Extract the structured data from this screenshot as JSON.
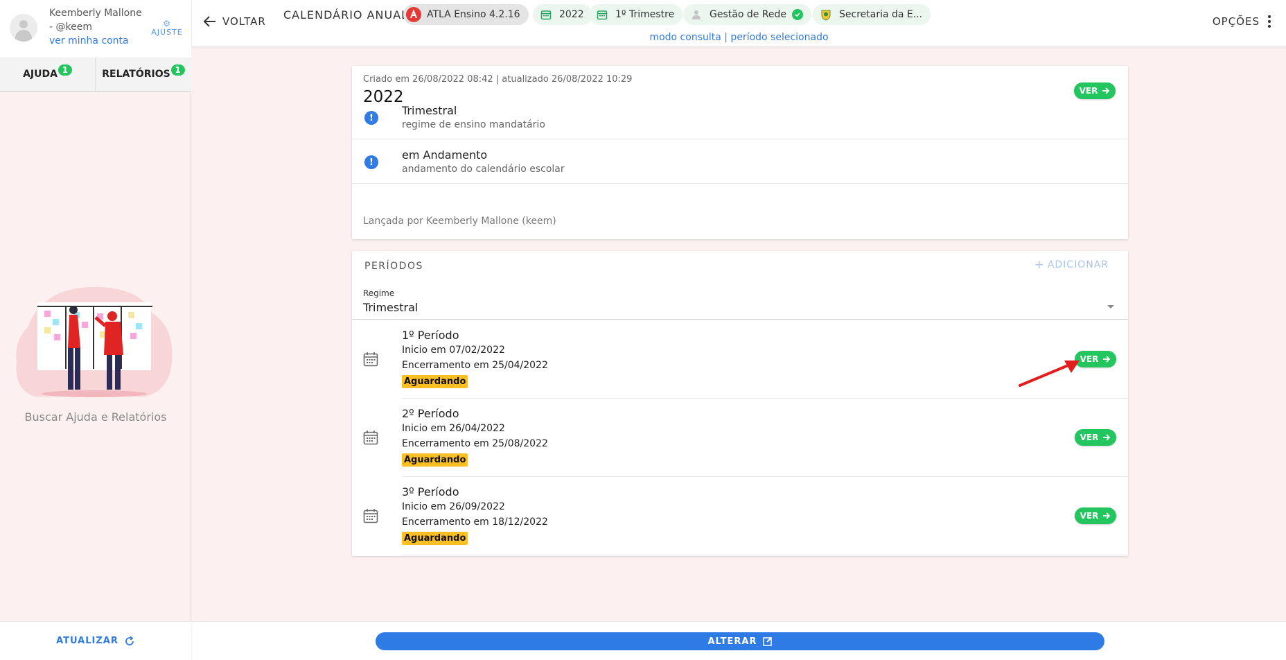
{
  "user": {
    "name": "Keemberly Mallone - @keem",
    "account_link": "ver minha conta",
    "settings_label": "AJUSTE"
  },
  "sidebar": {
    "tabs": [
      {
        "label": "AJUDA",
        "badge": "1"
      },
      {
        "label": "RELATÓRIOS",
        "badge": "1"
      }
    ],
    "help_text": "Buscar Ajuda e Relatórios",
    "refresh_label": "ATUALIZAR"
  },
  "header": {
    "back_label": "VOLTAR",
    "title": "CALENDÁRIO ANUAL",
    "chips": [
      {
        "label": "ATLA Ensino 4.2.16",
        "icon": "atla-logo-icon"
      },
      {
        "label": "2022",
        "icon": "calendar-icon"
      },
      {
        "label": "1º Trimestre",
        "icon": "calendar-icon"
      },
      {
        "label": "Gestão de Rede",
        "icon": "user-icon"
      },
      {
        "label": "Secretaria da E...",
        "icon": "crest-icon"
      }
    ],
    "status": "modo consulta | período selecionado",
    "options_label": "OPÇÕES"
  },
  "calendar": {
    "meta": "Criado em 26/08/2022 08:42 | atualizado 26/08/2022 10:29",
    "year": "2022",
    "view_label": "VER",
    "info": [
      {
        "title": "Trimestral",
        "subtitle": "regime de ensino mandatário"
      },
      {
        "title": "em Andamento",
        "subtitle": "andamento do calendário escolar"
      }
    ],
    "released_by": "Lançada por Keemberly Mallone (keem)"
  },
  "periods": {
    "section_title": "PERÍODOS",
    "add_label": "ADICIONAR",
    "regime_label": "Regime",
    "regime_value": "Trimestral",
    "items": [
      {
        "title": "1º Período",
        "start": "Inicio em 07/02/2022",
        "end": "Encerramento em 25/04/2022",
        "status": "Aguardando",
        "view_label": "VER"
      },
      {
        "title": "2º Período",
        "start": "Inicio em 26/04/2022",
        "end": "Encerramento em 25/08/2022",
        "status": "Aguardando",
        "view_label": "VER"
      },
      {
        "title": "3º Período",
        "start": "Inicio em 26/09/2022",
        "end": "Encerramento em 18/12/2022",
        "status": "Aguardando",
        "view_label": "VER"
      }
    ]
  },
  "footer": {
    "alter_label": "ALTERAR"
  },
  "colors": {
    "accent_blue": "#2f7be6",
    "success_green": "#22c55e",
    "badge_yellow": "#fbbf24",
    "background": "#fdf0f0"
  }
}
